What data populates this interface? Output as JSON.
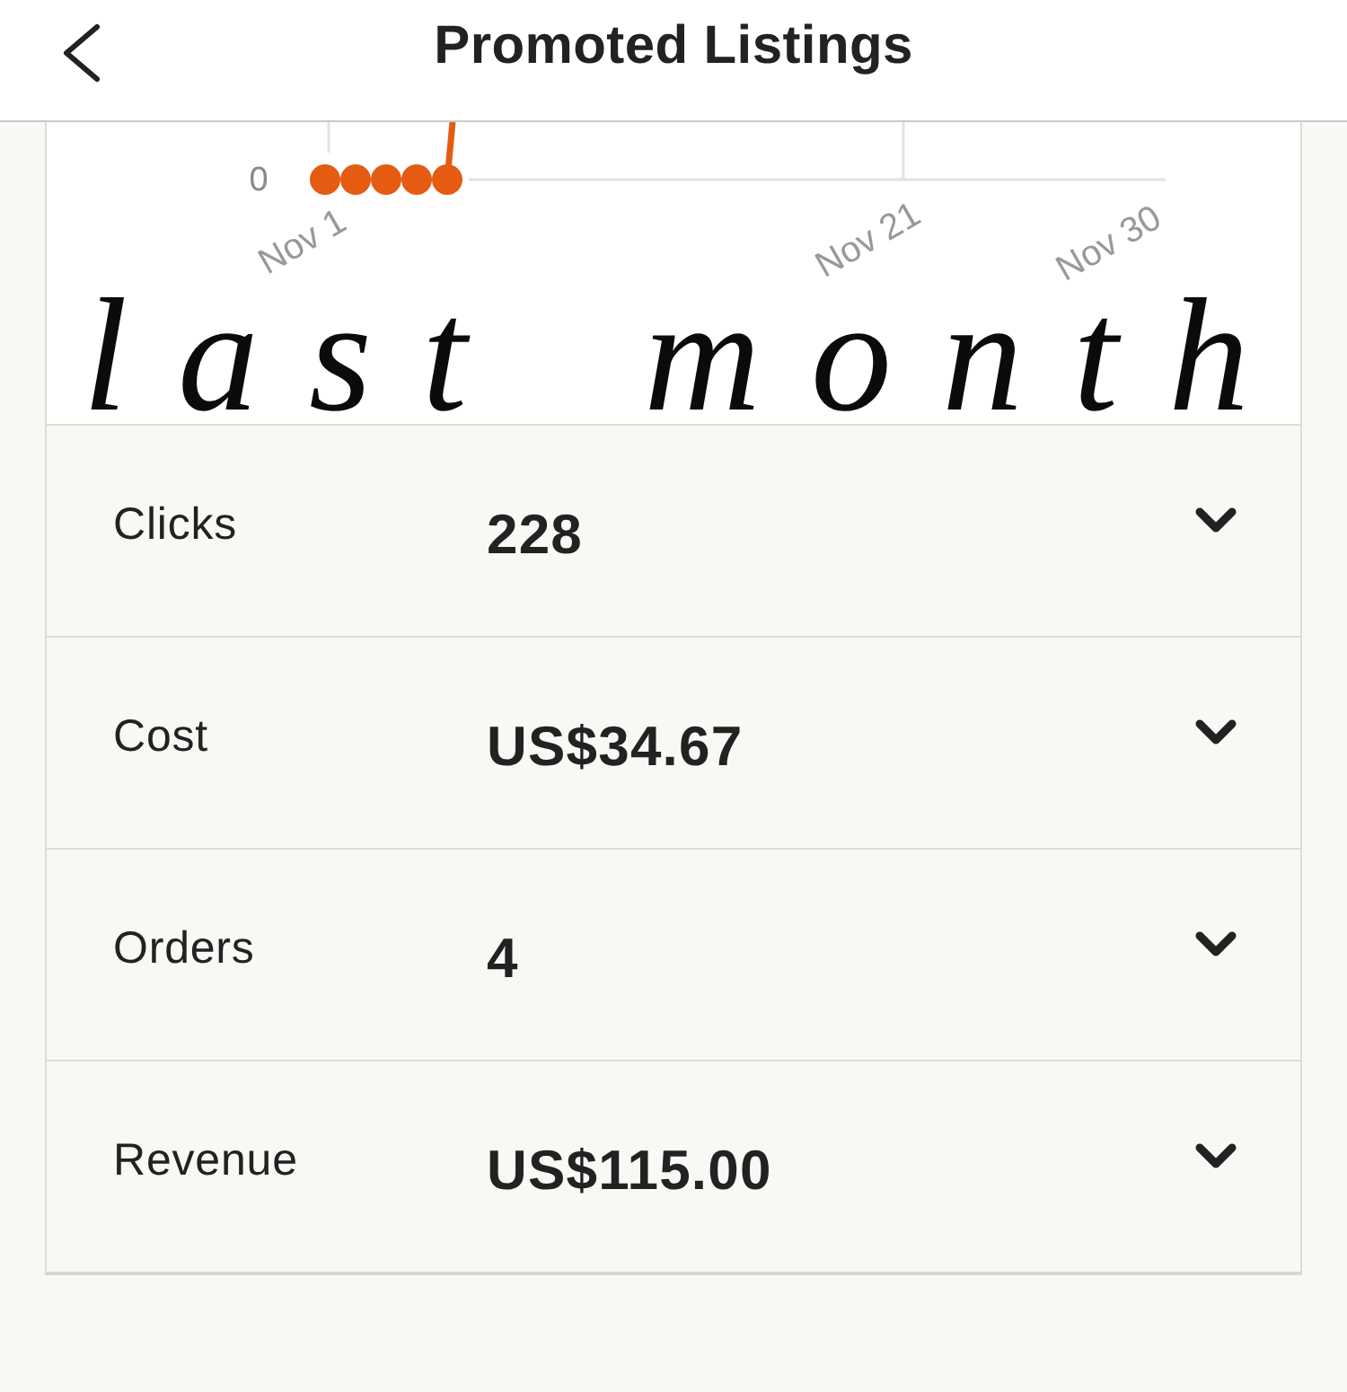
{
  "header": {
    "title": "Promoted Listings"
  },
  "chart": {
    "y_tick": "0",
    "x_labels": [
      "Nov 1",
      "Nov 21",
      "Nov 30"
    ]
  },
  "annotation": {
    "text": "last month"
  },
  "metrics": [
    {
      "label": "Clicks",
      "value": "228",
      "expanded": false
    },
    {
      "label": "Cost",
      "value": "US$34.67",
      "expanded": false
    },
    {
      "label": "Orders",
      "value": "4",
      "expanded": false
    },
    {
      "label": "Revenue",
      "value": "US$115.00",
      "expanded": false
    }
  ]
}
